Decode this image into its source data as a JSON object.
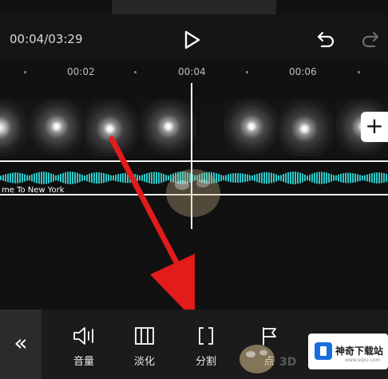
{
  "player": {
    "timecode": "00:04/03:29"
  },
  "ruler": {
    "labels": [
      "00:02",
      "00:04",
      "00:06"
    ]
  },
  "timeline": {
    "audio_clip_title": "me To New York",
    "add_clip_symbol": "+"
  },
  "toolbar": {
    "collapse_symbol": "«",
    "tools": [
      {
        "label": "音量",
        "icon": "volume-icon"
      },
      {
        "label": "淡化",
        "icon": "fade-icon"
      },
      {
        "label": "分割",
        "icon": "split-icon"
      },
      {
        "label": "点",
        "icon": "flag-icon"
      }
    ]
  },
  "watermark": {
    "site_name": "神奇下载站",
    "site_url": "www.sqxz.com",
    "corner_text": "3D"
  },
  "colors": {
    "waveform": "#2ec8c8",
    "annotation_arrow": "#e21b1b",
    "accent_badge": "#1a6fe0"
  }
}
